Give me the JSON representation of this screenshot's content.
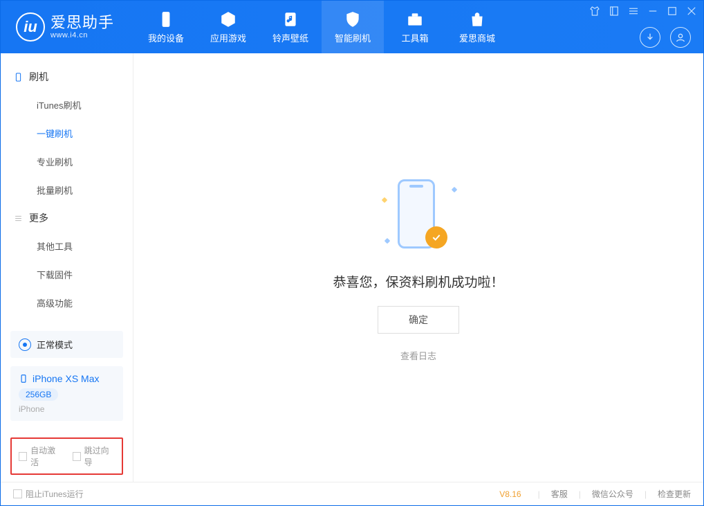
{
  "app": {
    "name": "爱思助手",
    "url": "www.i4.cn"
  },
  "tabs": [
    {
      "label": "我的设备"
    },
    {
      "label": "应用游戏"
    },
    {
      "label": "铃声壁纸"
    },
    {
      "label": "智能刷机"
    },
    {
      "label": "工具箱"
    },
    {
      "label": "爱思商城"
    }
  ],
  "sidebar": {
    "group1": {
      "title": "刷机",
      "items": [
        "iTunes刷机",
        "一键刷机",
        "专业刷机",
        "批量刷机"
      ]
    },
    "group2": {
      "title": "更多",
      "items": [
        "其他工具",
        "下载固件",
        "高级功能"
      ]
    },
    "mode": "正常模式",
    "device": {
      "name": "iPhone XS Max",
      "capacity": "256GB",
      "type": "iPhone"
    },
    "checkboxes": {
      "auto_activate": "自动激活",
      "skip_guide": "跳过向导"
    }
  },
  "main": {
    "success_message": "恭喜您，保资料刷机成功啦！",
    "confirm_label": "确定",
    "view_log": "查看日志"
  },
  "footer": {
    "block_itunes": "阻止iTunes运行",
    "version": "V8.16",
    "links": [
      "客服",
      "微信公众号",
      "检查更新"
    ]
  }
}
